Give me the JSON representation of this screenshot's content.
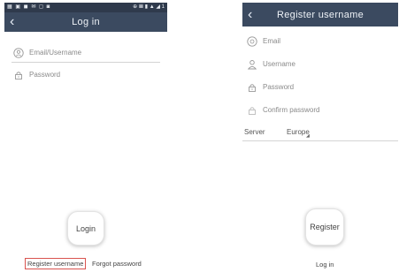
{
  "login_screen": {
    "status_bar": {
      "left_icons": "▦ ▣ ◼ ✉ ◻ ◙",
      "right_text": "⊕ 𝌆 ▮ ▲ ◢ 1"
    },
    "title": "Log in",
    "back_icon": "chevron-left-icon",
    "fields": [
      {
        "placeholder": "Email/Username",
        "icon": "user-circle-icon"
      },
      {
        "placeholder": "Password",
        "icon": "lock-icon"
      }
    ],
    "login_button": "Login",
    "register_link": "Register username",
    "forgot_link": "Forgot password"
  },
  "register_screen": {
    "title": "Register username",
    "back_icon": "chevron-left-icon",
    "fields": [
      {
        "placeholder": "Email",
        "icon": "at-icon"
      },
      {
        "placeholder": "Username",
        "icon": "user-icon"
      },
      {
        "placeholder": "Password",
        "icon": "lock-icon"
      },
      {
        "placeholder": "Confirm password",
        "icon": "lock-icon"
      }
    ],
    "server_label": "Server",
    "server_value": "Europe",
    "register_button": "Register",
    "login_link": "Log in"
  },
  "colors": {
    "navbar": "#3b4a60",
    "statusbar": "#2f3a4c",
    "highlight": "#d9534f"
  }
}
